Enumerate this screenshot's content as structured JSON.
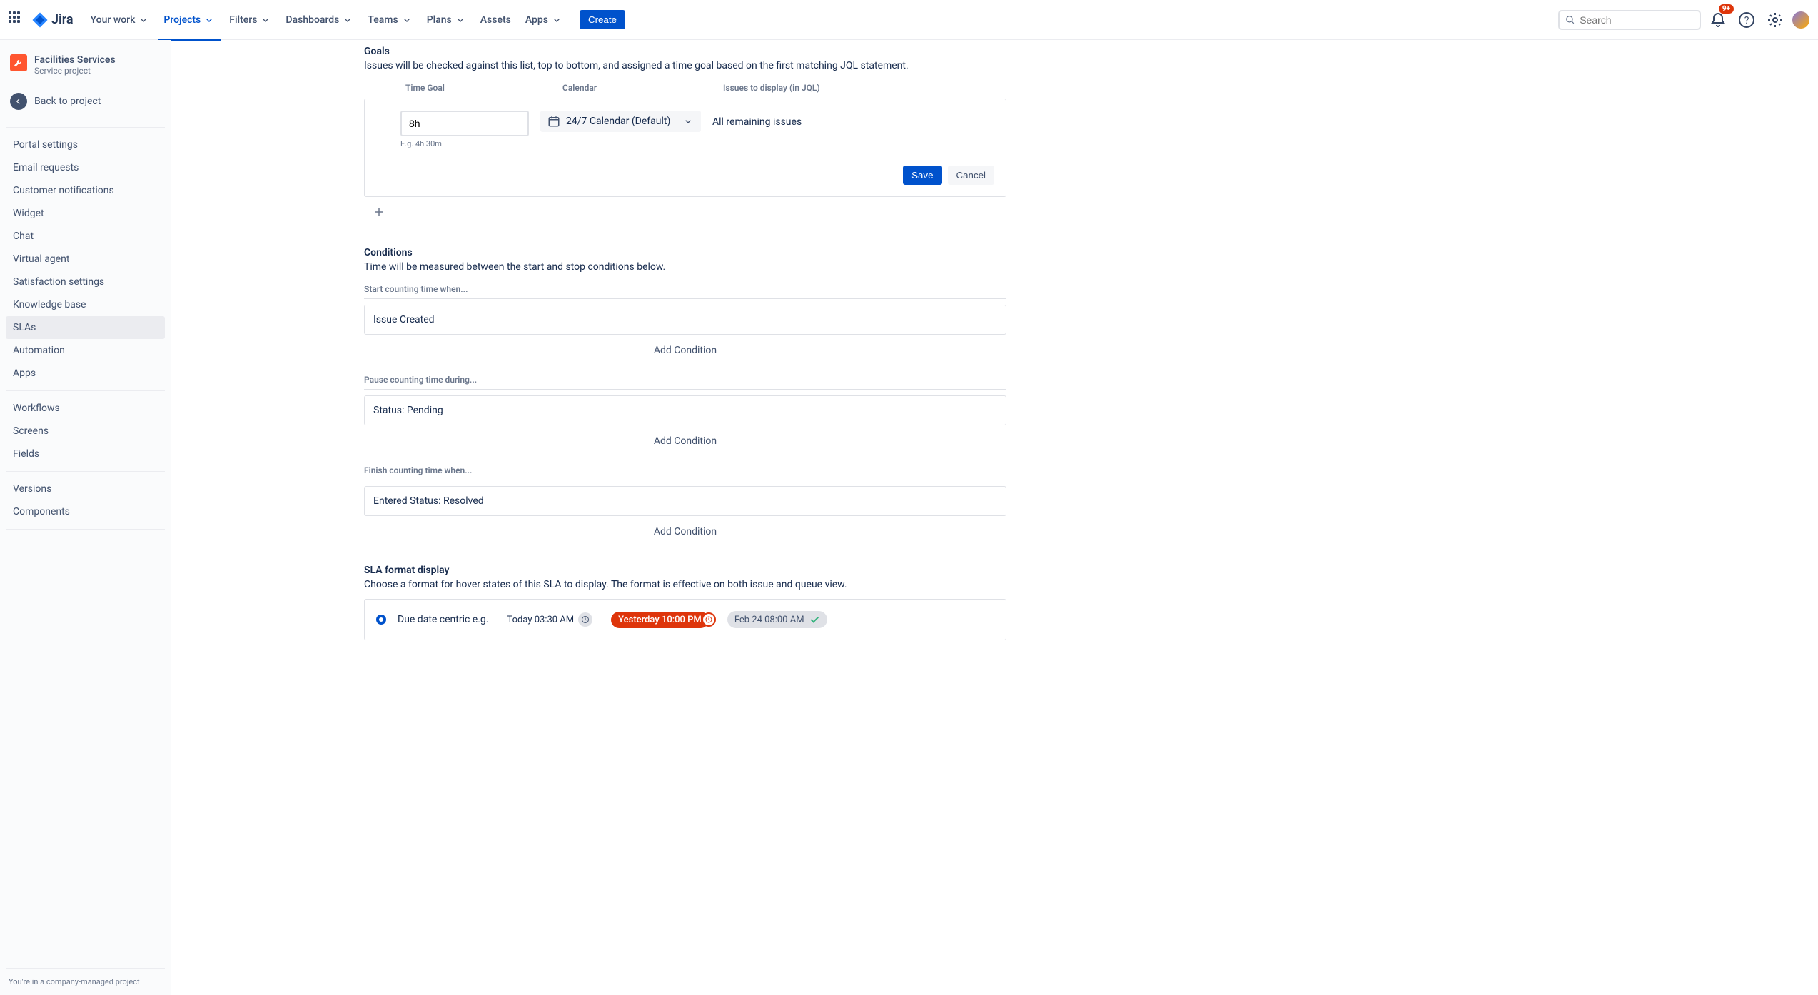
{
  "nav": {
    "logo_text": "Jira",
    "items": [
      "Your work",
      "Projects",
      "Filters",
      "Dashboards",
      "Teams",
      "Plans",
      "Assets",
      "Apps"
    ],
    "active_index": 1,
    "create": "Create",
    "search_placeholder": "Search",
    "notif_badge": "9+"
  },
  "sidebar": {
    "project_name": "Facilities Services",
    "project_type": "Service project",
    "back": "Back to project",
    "groups": [
      [
        "Portal settings",
        "Email requests",
        "Customer notifications",
        "Widget",
        "Chat",
        "Virtual agent",
        "Satisfaction settings",
        "Knowledge base",
        "SLAs",
        "Automation",
        "Apps"
      ],
      [
        "Workflows",
        "Screens",
        "Fields"
      ],
      [
        "Versions",
        "Components"
      ]
    ],
    "active": "SLAs",
    "footer": "You're in a company-managed project"
  },
  "goals": {
    "title": "Goals",
    "desc": "Issues will be checked against this list, top to bottom, and assigned a time goal based on the first matching JQL statement.",
    "headers": {
      "time": "Time Goal",
      "calendar": "Calendar",
      "jql": "Issues to display (in JQL)"
    },
    "time_value": "8h",
    "time_hint": "E.g. 4h 30m",
    "calendar": "24/7 Calendar (Default)",
    "jql_text": "All remaining issues",
    "save": "Save",
    "cancel": "Cancel"
  },
  "conditions": {
    "title": "Conditions",
    "desc": "Time will be measured between the start and stop conditions below.",
    "start_label": "Start counting time when...",
    "start_value": "Issue Created",
    "pause_label": "Pause counting time during...",
    "pause_value": "Status: Pending",
    "finish_label": "Finish counting time when...",
    "finish_value": "Entered Status: Resolved",
    "add": "Add Condition"
  },
  "format": {
    "title": "SLA format display",
    "desc": "Choose a format for hover states of this SLA to display. The format is effective on both issue and queue view.",
    "option_label": "Due date centric e.g.",
    "example1": "Today 03:30 AM",
    "example2": "Yesterday 10:00 PM",
    "example3": "Feb 24 08:00 AM"
  }
}
